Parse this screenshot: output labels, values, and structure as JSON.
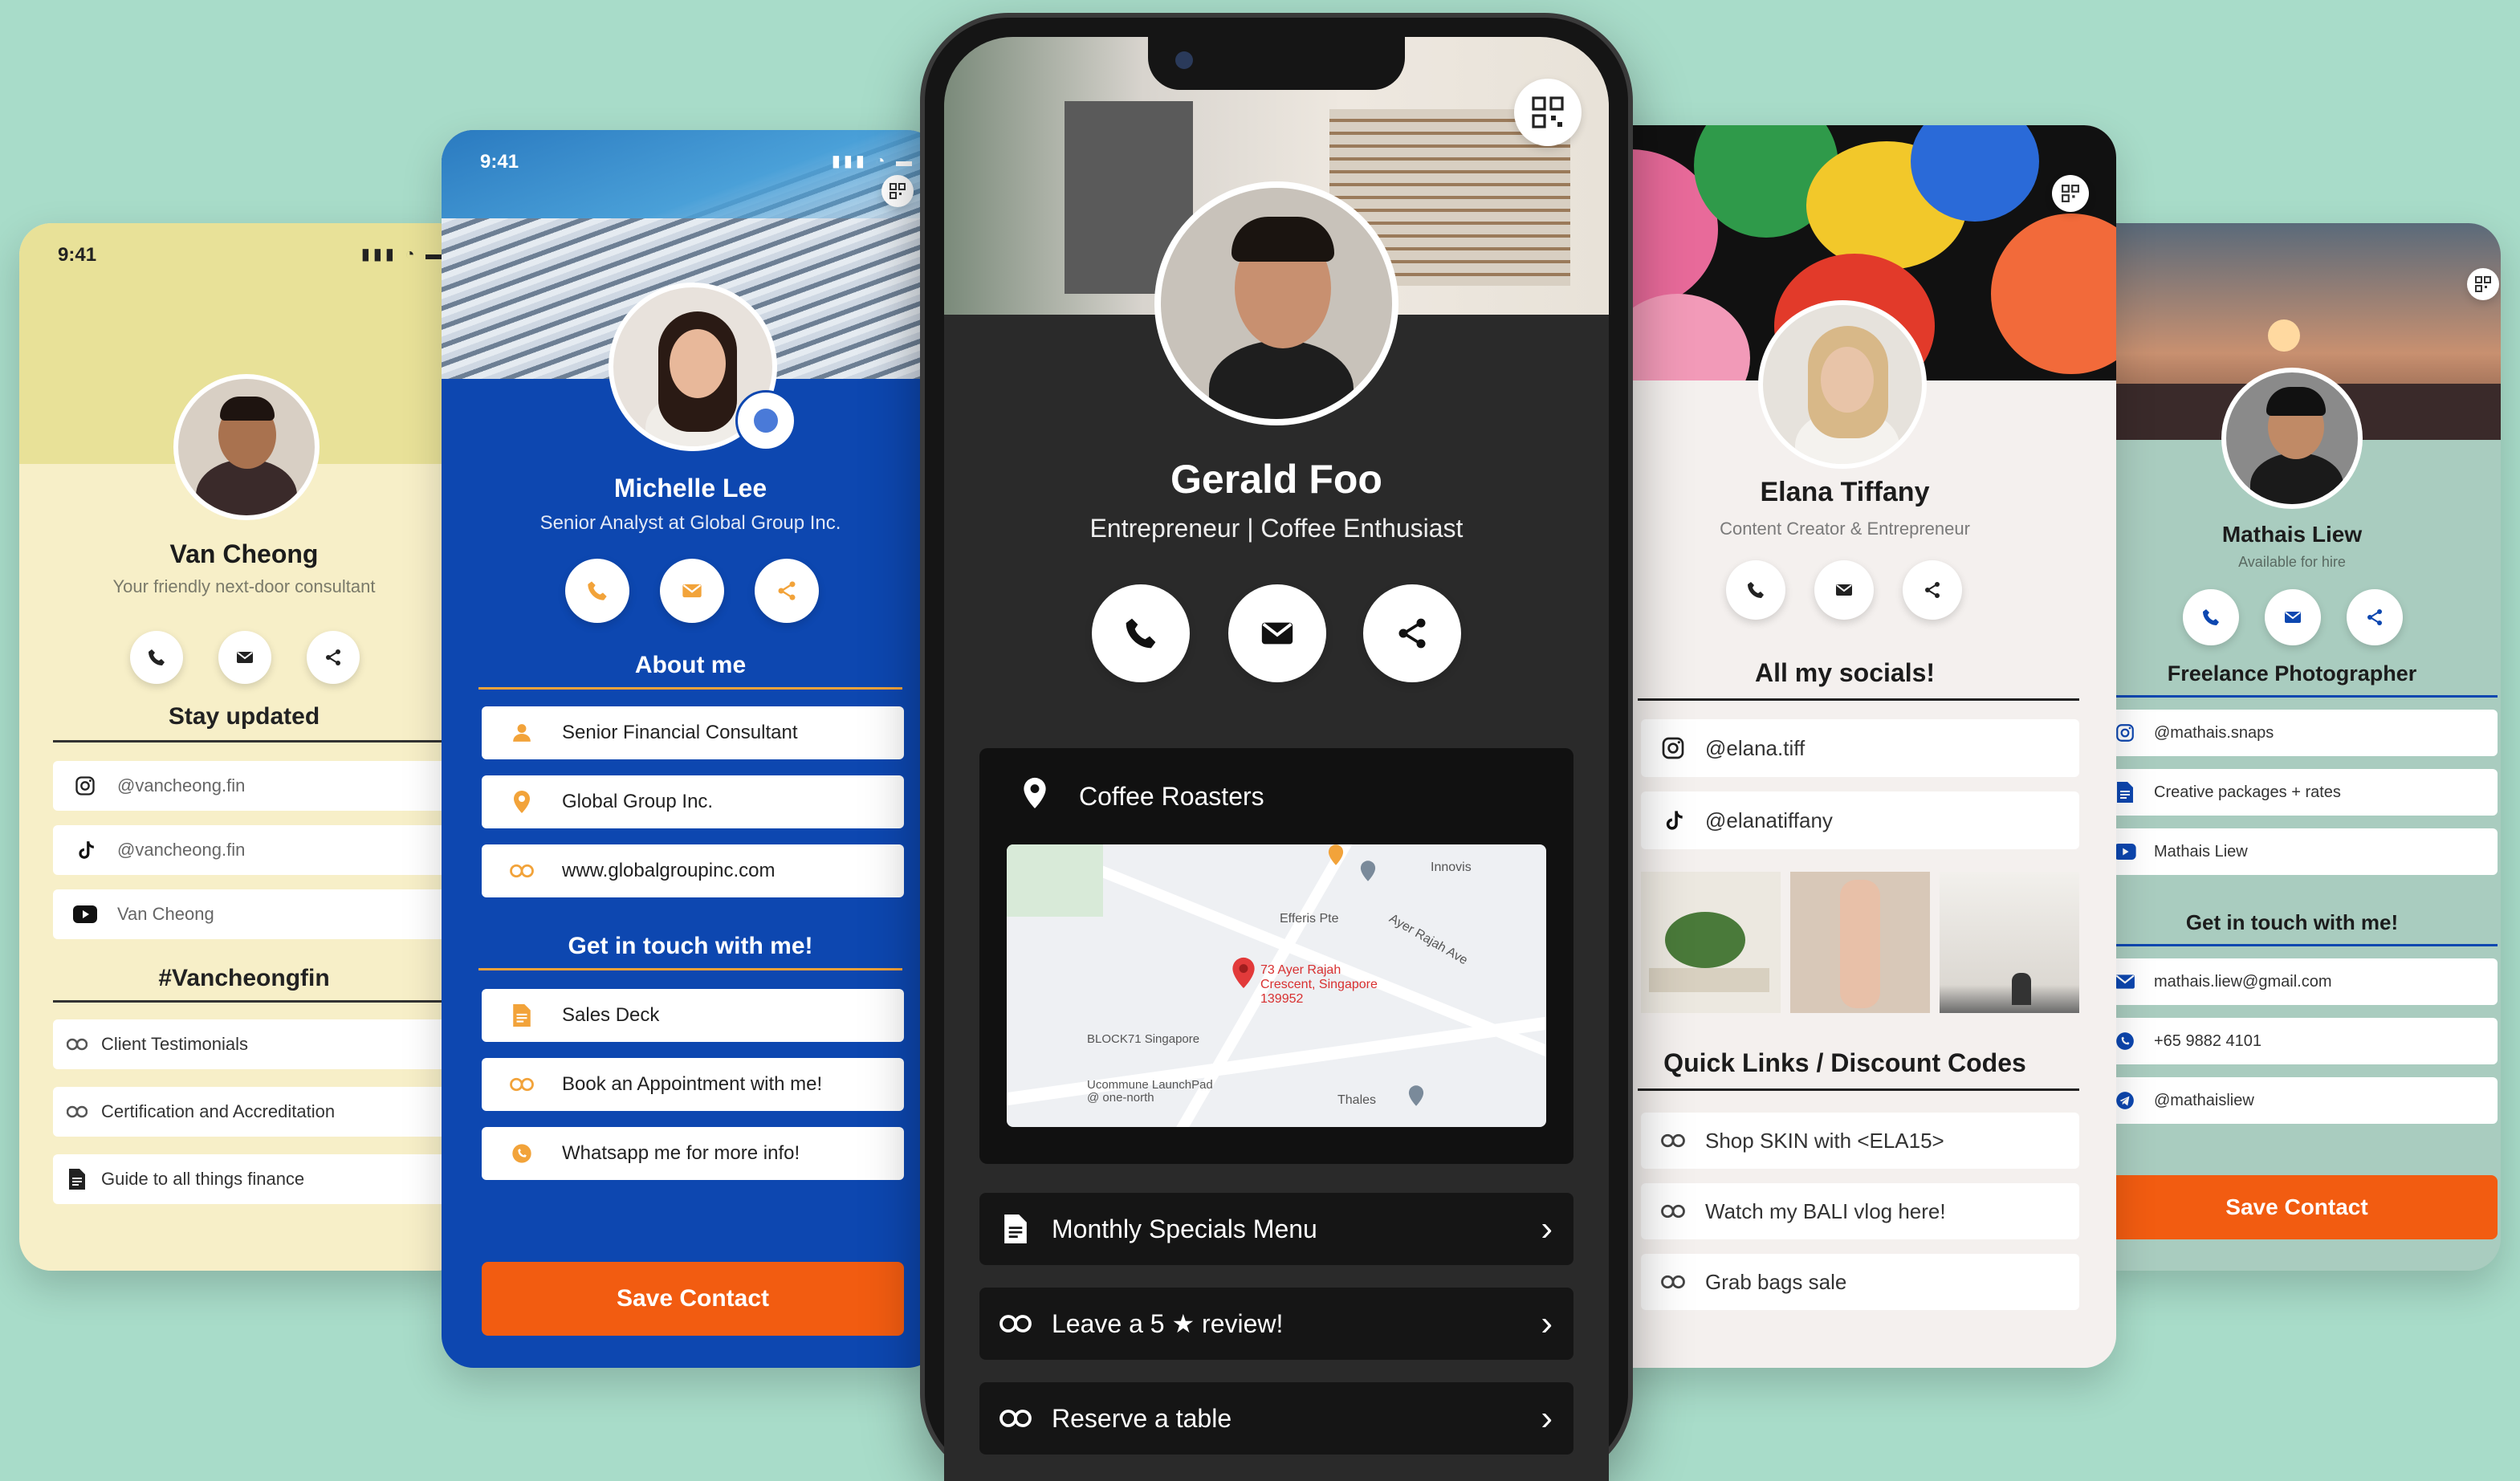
{
  "status_time": "9:41",
  "colors": {
    "background": "#a8dcc9",
    "van_bg": "#f7efc8",
    "van_header": "#e8e198",
    "michelle_bg": "#0d47b0",
    "orange": "#f25c11",
    "gerald_bg": "#2a2a2a",
    "elana_bg": "#f4f0ee",
    "mathais_bg": "#a9ccbf"
  },
  "van": {
    "name": "Van Cheong",
    "tagline": "Your friendly next-door consultant",
    "stay_updated": "Stay updated",
    "socials": [
      {
        "icon": "instagram-icon",
        "label": "@vancheong.fin"
      },
      {
        "icon": "tiktok-icon",
        "label": "@vancheong.fin"
      },
      {
        "icon": "youtube-icon",
        "label": "Van Cheong"
      }
    ],
    "hashtag": "#Vancheongfin",
    "links": [
      {
        "icon": "link-icon",
        "label": "Client Testimonials"
      },
      {
        "icon": "link-icon",
        "label": "Certification and Accreditation"
      },
      {
        "icon": "document-icon",
        "label": "Guide to all things finance"
      }
    ]
  },
  "michelle": {
    "name": "Michelle Lee",
    "title": "Senior Analyst at Global Group Inc.",
    "about_me": "About me",
    "about_rows": [
      {
        "icon": "person-icon",
        "label": "Senior Financial Consultant"
      },
      {
        "icon": "location-pin-icon",
        "label": "Global Group Inc."
      },
      {
        "icon": "link-icon",
        "label": "www.globalgroupinc.com"
      }
    ],
    "get_in_touch": "Get in touch with me!",
    "touch_rows": [
      {
        "icon": "document-icon",
        "label": "Sales Deck"
      },
      {
        "icon": "link-icon",
        "label": "Book an Appointment with me!"
      },
      {
        "icon": "whatsapp-icon",
        "label": "Whatsapp me for more info!"
      }
    ],
    "save_contact": "Save Contact"
  },
  "gerald": {
    "name": "Gerald Foo",
    "title": "Entrepreneur | Coffee Enthusiast",
    "location_label": "Coffee Roasters",
    "map_labels": {
      "address": "73 Ayer Rajah Crescent, Singapore 139952",
      "block": "BLOCK71 Singapore",
      "launchpad": "Ucommune LaunchPad @ one-north",
      "innovis": "Innovis",
      "efferis": "Efferis Pte",
      "ayer_rajah": "Ayer Rajah Ave",
      "thales": "Thales"
    },
    "links": [
      {
        "icon": "document-icon",
        "label": "Monthly Specials Menu"
      },
      {
        "icon": "link-icon",
        "label": "Leave a 5 ★ review!"
      },
      {
        "icon": "link-icon",
        "label": "Reserve a table"
      }
    ]
  },
  "elana": {
    "name": "Elana Tiffany",
    "title": "Content Creator & Entrepreneur",
    "socials_title": "All my socials!",
    "socials": [
      {
        "icon": "instagram-icon",
        "label": "@elana.tiff"
      },
      {
        "icon": "tiktok-icon",
        "label": "@elanatiffany"
      }
    ],
    "quick_links_title": "Quick Links / Discount Codes",
    "links": [
      {
        "icon": "link-icon",
        "label": "Shop SKIN with <ELA15>"
      },
      {
        "icon": "link-icon",
        "label": "Watch my BALI vlog here!"
      },
      {
        "icon": "link-icon",
        "label": "Grab bags sale"
      }
    ]
  },
  "mathais": {
    "name": "Mathais Liew",
    "availability": "Available for hire",
    "role": "Freelance Photographer",
    "links": [
      {
        "icon": "instagram-icon",
        "label": "@mathais.snaps"
      },
      {
        "icon": "document-icon",
        "label": "Creative packages + rates"
      },
      {
        "icon": "youtube-icon",
        "label": "Mathais Liew"
      }
    ],
    "get_in_touch": "Get in touch with me!",
    "contacts": [
      {
        "icon": "email-icon",
        "label": "mathais.liew@gmail.com"
      },
      {
        "icon": "whatsapp-icon",
        "label": "+65 9882 4101"
      },
      {
        "icon": "telegram-icon",
        "label": "@mathaisliew"
      }
    ],
    "save_contact": "Save Contact"
  }
}
